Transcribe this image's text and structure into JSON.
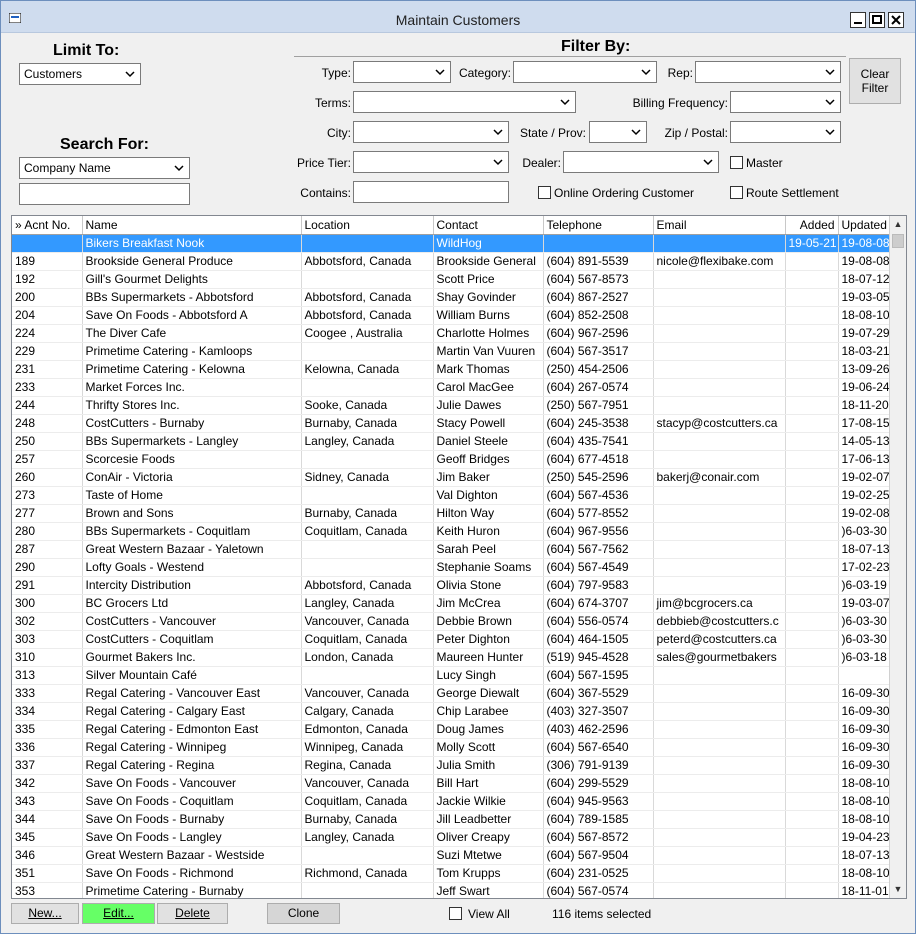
{
  "window": {
    "title": "Maintain Customers"
  },
  "limit": {
    "label": "Limit To:",
    "value": "Customers"
  },
  "search": {
    "label": "Search For:",
    "field_value": "Company Name",
    "text": ""
  },
  "filter": {
    "label": "Filter By:",
    "type_label": "Type:",
    "category_label": "Category:",
    "rep_label": "Rep:",
    "terms_label": "Terms:",
    "billing_label": "Billing Frequency:",
    "city_label": "City:",
    "state_label": "State / Prov:",
    "zip_label": "Zip / Postal:",
    "price_tier_label": "Price Tier:",
    "dealer_label": "Dealer:",
    "contains_label": "Contains:",
    "master_label": "Master",
    "online_label": "Online Ordering Customer",
    "route_label": "Route Settlement",
    "clear_line1": "Clear",
    "clear_line2": "Filter"
  },
  "table": {
    "columns": [
      "» Acnt No.",
      "Name",
      "Location",
      "Contact",
      "Telephone",
      "Email",
      "Added",
      "Updated"
    ],
    "rows": [
      [
        "",
        "Bikers Breakfast Nook",
        "",
        "WildHog",
        "",
        "",
        "19-05-21",
        "19-08-08"
      ],
      [
        "189",
        "Brookside General Produce",
        "Abbotsford, Canada",
        "Brookside General",
        "(604) 891-5539",
        "nicole@flexibake.com",
        "",
        "19-08-08"
      ],
      [
        "192",
        "Gill's Gourmet Delights",
        "",
        "Scott Price",
        "(604) 567-8573",
        "",
        "",
        "18-07-12"
      ],
      [
        "200",
        "BBs Supermarkets - Abbotsford",
        "Abbotsford, Canada",
        "Shay Govinder",
        "(604) 867-2527",
        "",
        "",
        "19-03-05"
      ],
      [
        "204",
        "Save On Foods - Abbotsford  A",
        "Abbotsford, Canada",
        "William Burns",
        "(604) 852-2508",
        "",
        "",
        "18-08-10"
      ],
      [
        "224",
        "The Diver Cafe",
        "Coogee , Australia",
        "Charlotte Holmes",
        "(604) 967-2596",
        "",
        "",
        "19-07-29"
      ],
      [
        "229",
        "Primetime Catering - Kamloops",
        "",
        "Martin Van Vuuren",
        "(604) 567-3517",
        "",
        "",
        "18-03-21"
      ],
      [
        "231",
        "Primetime Catering - Kelowna",
        "Kelowna, Canada",
        "Mark Thomas",
        "(250) 454-2506",
        "",
        "",
        "13-09-26"
      ],
      [
        "233",
        "Market Forces Inc.",
        "",
        "Carol MacGee",
        "(604) 267-0574",
        "",
        "",
        "19-06-24"
      ],
      [
        "244",
        "Thrifty Stores Inc.",
        "Sooke, Canada",
        "Julie Dawes",
        "(250) 567-7951",
        "",
        "",
        "18-11-20"
      ],
      [
        "248",
        "CostCutters - Burnaby",
        "Burnaby, Canada",
        "Stacy Powell",
        "(604) 245-3538",
        "stacyp@costcutters.ca",
        "",
        "17-08-15"
      ],
      [
        "250",
        "BBs Supermarkets - Langley",
        "Langley, Canada",
        "Daniel Steele",
        "(604) 435-7541",
        "",
        "",
        "14-05-13"
      ],
      [
        "257",
        "Scorcesie Foods",
        "",
        "Geoff Bridges",
        "(604) 677-4518",
        "",
        "",
        "17-06-13"
      ],
      [
        "260",
        "ConAir - Victoria",
        "Sidney, Canada",
        "Jim Baker",
        "(250) 545-2596",
        "bakerj@conair.com",
        "",
        "19-02-07"
      ],
      [
        "273",
        "Taste of Home",
        "",
        "Val Dighton",
        "(604) 567-4536",
        "",
        "",
        "19-02-25"
      ],
      [
        "277",
        "Brown and Sons",
        "Burnaby, Canada",
        "Hilton Way",
        "(604) 577-8552",
        "",
        "",
        "19-02-08"
      ],
      [
        "280",
        "BBs Supermarkets - Coquitlam",
        "Coquitlam, Canada",
        "Keith Huron",
        "(604) 967-9556",
        "",
        "",
        ")6-03-30"
      ],
      [
        "287",
        "Great Western Bazaar - Yaletown",
        "",
        "Sarah Peel",
        "(604) 567-7562",
        "",
        "",
        "18-07-13"
      ],
      [
        "290",
        "Lofty Goals - Westend",
        "",
        "Stephanie Soams",
        "(604) 567-4549",
        "",
        "",
        "17-02-23"
      ],
      [
        "291",
        "Intercity Distribution",
        "Abbotsford, Canada",
        "Olivia Stone",
        "(604) 797-9583",
        "",
        "",
        ")6-03-19"
      ],
      [
        "300",
        "BC Grocers Ltd",
        "Langley, Canada",
        "Jim McCrea",
        "(604) 674-3707",
        "jim@bcgrocers.ca",
        "",
        "19-03-07"
      ],
      [
        "302",
        "CostCutters - Vancouver",
        "Vancouver, Canada",
        "Debbie Brown",
        "(604) 556-0574",
        "debbieb@costcutters.c",
        "",
        ")6-03-30"
      ],
      [
        "303",
        "CostCutters - Coquitlam",
        "Coquitlam, Canada",
        "Peter Dighton",
        "(604) 464-1505",
        "peterd@costcutters.ca",
        "",
        ")6-03-30"
      ],
      [
        "310",
        "Gourmet Bakers Inc.",
        "London, Canada",
        "Maureen Hunter",
        "(519) 945-4528",
        "sales@gourmetbakers",
        "",
        ")6-03-18"
      ],
      [
        "313",
        "Silver Mountain Café",
        "",
        "Lucy Singh",
        "(604) 567-1595",
        "",
        "",
        ""
      ],
      [
        "333",
        "Regal Catering - Vancouver East",
        "Vancouver, Canada",
        "George Diewalt",
        "(604) 367-5529",
        "",
        "",
        "16-09-30"
      ],
      [
        "334",
        "Regal Catering - Calgary East",
        "Calgary, Canada",
        "Chip Larabee",
        "(403) 327-3507",
        "",
        "",
        "16-09-30"
      ],
      [
        "335",
        "Regal Catering - Edmonton East",
        "Edmonton, Canada",
        "Doug James",
        "(403) 462-2596",
        "",
        "",
        "16-09-30"
      ],
      [
        "336",
        "Regal Catering - Winnipeg",
        "Winnipeg, Canada",
        "Molly Scott",
        "(604) 567-6540",
        "",
        "",
        "16-09-30"
      ],
      [
        "337",
        "Regal Catering - Regina",
        "Regina, Canada",
        "Julia Smith",
        "(306) 791-9139",
        "",
        "",
        "16-09-30"
      ],
      [
        "342",
        "Save On Foods - Vancouver",
        "Vancouver, Canada",
        "Bill Hart",
        "(604) 299-5529",
        "",
        "",
        "18-08-10"
      ],
      [
        "343",
        "Save On Foods - Coquitlam",
        "Coquitlam, Canada",
        "Jackie Wilkie",
        "(604) 945-9563",
        "",
        "",
        "18-08-10"
      ],
      [
        "344",
        "Save On Foods - Burnaby",
        "Burnaby, Canada",
        "Jill Leadbetter",
        "(604) 789-1585",
        "",
        "",
        "18-08-10"
      ],
      [
        "345",
        "Save On Foods - Langley",
        "Langley, Canada",
        "Oliver Creapy",
        "(604) 567-8572",
        "",
        "",
        "19-04-23"
      ],
      [
        "346",
        "Great Western Bazaar - Westside",
        "",
        "Suzi Mtetwe",
        "(604) 567-9504",
        "",
        "",
        "18-07-13"
      ],
      [
        "351",
        "Save On Foods - Richmond",
        "Richmond, Canada",
        "Tom Krupps",
        "(604) 231-0525",
        "",
        "",
        "18-08-10"
      ],
      [
        "353",
        "Primetime Catering - Burnaby",
        "",
        "Jeff Swart",
        "(604) 567-0574",
        "",
        "",
        "18-11-01"
      ]
    ]
  },
  "footer": {
    "new_label": "New...",
    "edit_label": "Edit...",
    "delete_label": "Delete",
    "clone_label": "Clone",
    "view_all_label": "View All",
    "status": "116 items selected"
  },
  "colors": {
    "selected_row": "#3399ff",
    "edit_button": "#66ff66",
    "titlebar": "#cfdcee"
  }
}
